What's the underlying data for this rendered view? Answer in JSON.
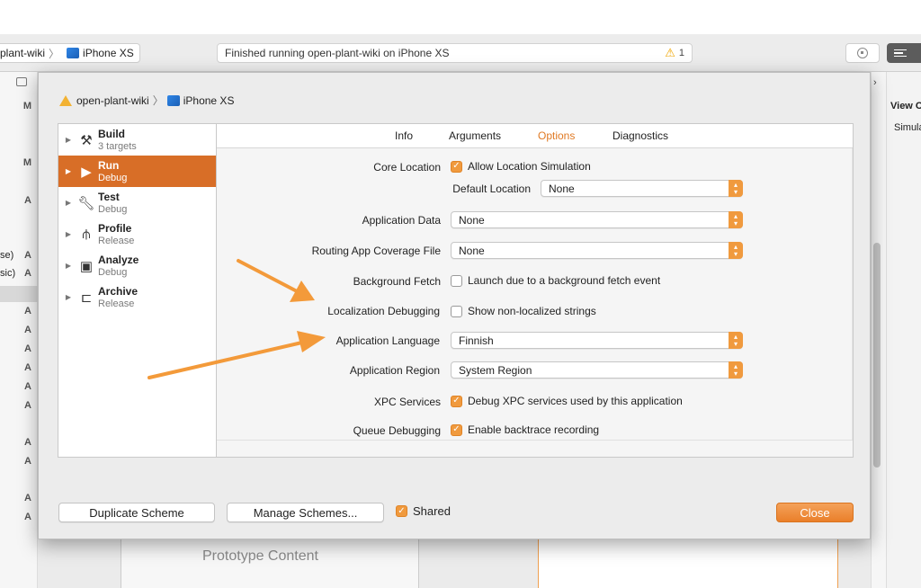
{
  "toolbar": {
    "scheme_name": "plant-wiki",
    "scheme_device": "iPhone XS",
    "status_text": "Finished running open-plant-wiki on iPhone XS",
    "warning_count": "1"
  },
  "navigator_fragments": {
    "letters": [
      "M",
      "M",
      "A",
      "A",
      "A",
      "A",
      "A",
      "A",
      "A",
      "A",
      "A",
      "A",
      "A",
      "A",
      "A"
    ],
    "frag1": "se)",
    "frag2": "sic)"
  },
  "inspector": {
    "title": "View C",
    "subtitle": "Simula"
  },
  "canvas": {
    "prototype_label": "Prototype Content"
  },
  "sheet": {
    "breadcrumb_project": "open-plant-wiki",
    "breadcrumb_device": "iPhone XS",
    "actions": [
      {
        "name": "Build",
        "sub": "3 targets",
        "icon": "hammer-icon"
      },
      {
        "name": "Run",
        "sub": "Debug",
        "icon": "play-icon"
      },
      {
        "name": "Test",
        "sub": "Debug",
        "icon": "wrench-icon"
      },
      {
        "name": "Profile",
        "sub": "Release",
        "icon": "instruments-icon"
      },
      {
        "name": "Analyze",
        "sub": "Debug",
        "icon": "analyze-icon"
      },
      {
        "name": "Archive",
        "sub": "Release",
        "icon": "archive-icon"
      }
    ],
    "tabs": [
      "Info",
      "Arguments",
      "Options",
      "Diagnostics"
    ],
    "active_tab": "Options",
    "options": {
      "core_location_label": "Core Location",
      "allow_location_simulation": "Allow Location Simulation",
      "default_location_label": "Default Location",
      "default_location_value": "None",
      "application_data_label": "Application Data",
      "application_data_value": "None",
      "routing_label": "Routing App Coverage File",
      "routing_value": "None",
      "background_fetch_label": "Background Fetch",
      "background_fetch_check": "Launch due to a background fetch event",
      "localization_label": "Localization Debugging",
      "localization_check": "Show non-localized strings",
      "app_language_label": "Application Language",
      "app_language_value": "Finnish",
      "app_region_label": "Application Region",
      "app_region_value": "System Region",
      "xpc_label": "XPC Services",
      "xpc_check": "Debug XPC services used by this application",
      "queue_label": "Queue Debugging",
      "queue_check": "Enable backtrace recording"
    },
    "footer": {
      "duplicate": "Duplicate Scheme",
      "manage": "Manage Schemes...",
      "shared": "Shared",
      "close": "Close"
    }
  },
  "colors": {
    "accent": "#e07a24",
    "selection": "#d86e27",
    "arrow": "#f39a3a"
  }
}
